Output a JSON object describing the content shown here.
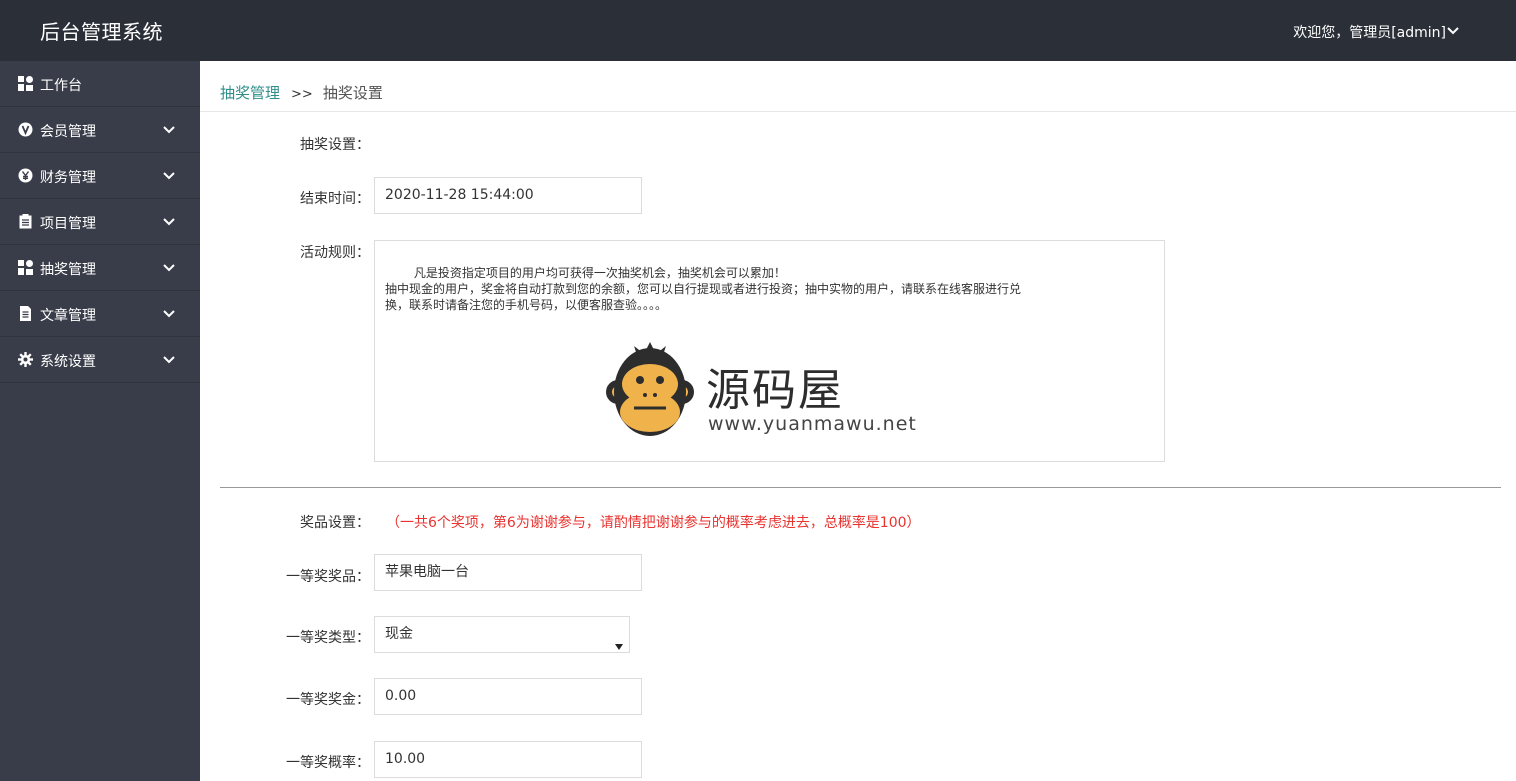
{
  "header": {
    "title": "后台管理系统",
    "welcome": "欢迎您，管理员[admin]"
  },
  "sidebar": {
    "items": [
      {
        "label": "工作台",
        "icon": "dashboard-icon",
        "has_arrow": false
      },
      {
        "label": "会员管理",
        "icon": "v-circle-icon",
        "has_arrow": true
      },
      {
        "label": "财务管理",
        "icon": "yen-circle-icon",
        "has_arrow": true
      },
      {
        "label": "项目管理",
        "icon": "clipboard-icon",
        "has_arrow": true
      },
      {
        "label": "抽奖管理",
        "icon": "dashboard-icon",
        "has_arrow": true
      },
      {
        "label": "文章管理",
        "icon": "document-icon",
        "has_arrow": true
      },
      {
        "label": "系统设置",
        "icon": "gear-icon",
        "has_arrow": true
      }
    ]
  },
  "breadcrumb": {
    "parent": "抽奖管理",
    "separator": ">>",
    "current": "抽奖设置"
  },
  "form": {
    "section_label": "抽奖设置：",
    "end_time_label": "结束时间：",
    "end_time_value": "2020-11-28 15:44:00",
    "rules_label": "活动规则：",
    "rules_value": "凡是投资指定项目的用户均可获得一次抽奖机会，抽奖机会可以累加！\n抽中现金的用户，奖金将自动打款到您的余额，您可以自行提现或者进行投资；抽中实物的用户，请联系在线客服进行兑\n换，联系时请备注您的手机号码，以便客服查验。。。。",
    "prize_settings_label": "奖品设置：",
    "prize_note": "（一共6个奖项，第6为谢谢参与，请酌情把谢谢参与的概率考虑进去，总概率是100）",
    "first_prize_item_label": "一等奖奖品：",
    "first_prize_item_value": "苹果电脑一台",
    "first_prize_type_label": "一等奖类型：",
    "first_prize_type_value": "现金",
    "first_prize_amount_label": "一等奖奖金：",
    "first_prize_amount_value": "0.00",
    "first_prize_prob_label": "一等奖概率：",
    "first_prize_prob_value": "10.00"
  },
  "watermark": {
    "title": "源码屋",
    "url": "www.yuanmawu.net"
  },
  "colors": {
    "topbar": "#2b2f38",
    "sidebar": "#393d49",
    "link": "#2f8f8a",
    "note": "#e8332f"
  }
}
